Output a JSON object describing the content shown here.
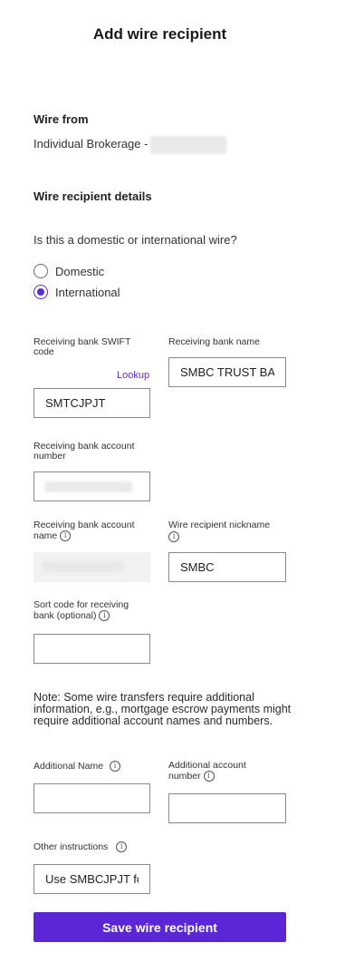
{
  "title": "Add wire recipient",
  "wire_from": {
    "heading": "Wire from",
    "account": "Individual Brokerage -"
  },
  "recipient_details": {
    "heading": "Wire recipient details"
  },
  "wire_type": {
    "question": "Is this a domestic or international wire?",
    "options": [
      "Domestic",
      "International"
    ],
    "selected": "International"
  },
  "fields": {
    "swift": {
      "label": "Receiving bank SWIFT code",
      "value": "SMTCJPJT",
      "lookup": "Lookup"
    },
    "bank_name": {
      "label": "Receiving bank name",
      "value": "SMBC TRUST BAN"
    },
    "account_number": {
      "label": "Receiving bank account number",
      "value": ""
    },
    "account_name": {
      "label": "Receiving bank account name",
      "value": ""
    },
    "nickname": {
      "label": "Wire recipient nickname",
      "value": "SMBC"
    },
    "sort_code": {
      "label": "Sort code for receiving bank (optional)",
      "value": ""
    },
    "additional_name": {
      "label": "Additional Name",
      "value": ""
    },
    "additional_account": {
      "label": "Additional account number",
      "value": ""
    },
    "other_instructions": {
      "label": "Other instructions",
      "value": "Use SMBCJPJT fo"
    }
  },
  "note": "Note: Some wire transfers require additional information, e.g., mortgage escrow payments might require additional account names and numbers.",
  "save_button": "Save wire recipient",
  "info_glyph": "i",
  "icons": {
    "info": "info-icon"
  },
  "colors": {
    "accent": "#5a26d6",
    "radio_selected": "#5b2bd6"
  }
}
